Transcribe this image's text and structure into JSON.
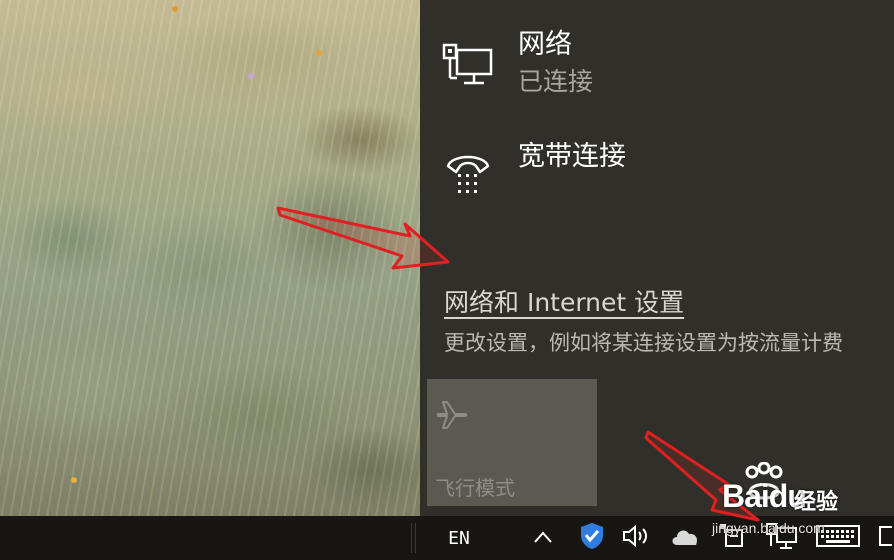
{
  "flyout": {
    "connections": [
      {
        "name": "网络",
        "status": "已连接",
        "icon": "ethernet-monitor-icon"
      },
      {
        "name": "宽带连接",
        "status": "",
        "icon": "dialup-phone-icon"
      }
    ],
    "settings_link": "网络和 Internet 设置",
    "settings_desc": "更改设置，例如将某连接设置为按流量计费",
    "quick_actions": [
      {
        "label": "飞行模式",
        "icon": "airplane-icon",
        "state": "off"
      }
    ]
  },
  "taskbar": {
    "language": "EN",
    "tray_icons": [
      "chevron-up-icon",
      "shield-icon",
      "volume-icon",
      "cloud-icon",
      "usb-device-icon",
      "network-icon",
      "keyboard-icon"
    ]
  },
  "watermark": {
    "brand": "Bai",
    "brand_suffix": "du",
    "brand_cn": "经验",
    "url": "jingyan.baidu.com"
  },
  "colors": {
    "flyout_bg": "#302f29",
    "taskbar_bg": "#181612",
    "tile_bg": "#5b5950",
    "annotation_red": "#e02020",
    "shield_blue": "#2f7de1"
  }
}
